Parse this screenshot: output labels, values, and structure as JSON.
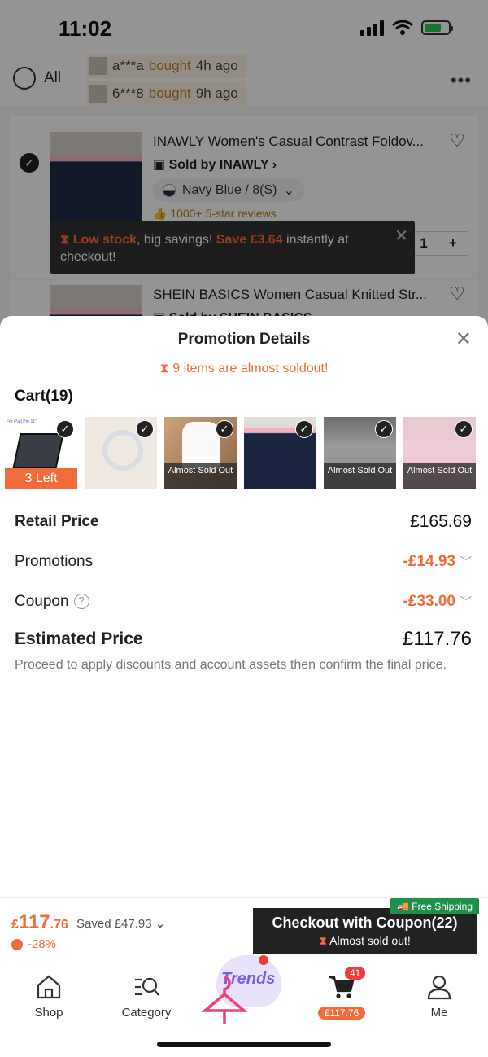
{
  "status": {
    "time": "11:02"
  },
  "cart_header": {
    "all_label": "All",
    "recent": [
      {
        "user": "a***a",
        "action": "bought",
        "when": "4h ago"
      },
      {
        "user": "6***8",
        "action": "bought",
        "when": "9h ago"
      }
    ]
  },
  "items": [
    {
      "title": "INAWLY Women's Casual Contrast Foldov...",
      "seller": "Sold by INAWLY",
      "variant": "Navy Blue / 8(S)",
      "reviews": "1000+ 5-star reviews",
      "qty": "1"
    },
    {
      "title": "SHEIN BASICS Women Casual Knitted Str...",
      "seller": "Sold by SHEIN BASICS"
    }
  ],
  "toast": {
    "part1": "Low stock",
    "part2": ", big savings! ",
    "part3": "Save £3.64",
    "part4": " instantly at checkout!"
  },
  "sheet": {
    "title": "Promotion Details",
    "soldout_note": "9 items are almost soldout!",
    "cart_label": "Cart(19)",
    "thumbs": [
      {
        "badge": "3 Left"
      },
      {
        "badge": ""
      },
      {
        "badge": "Almost Sold Out"
      },
      {
        "badge": ""
      },
      {
        "badge": "Almost Sold Out"
      },
      {
        "badge": "Almost Sold Out"
      }
    ],
    "retail_label": "Retail Price",
    "retail_value": "£165.69",
    "promotions_label": "Promotions",
    "promotions_value": "-£14.93",
    "coupon_label": "Coupon",
    "coupon_value": "-£33.00",
    "estimated_label": "Estimated Price",
    "estimated_value": "£117.76",
    "disclaimer": "Proceed to apply discounts and account assets then confirm the final price."
  },
  "checkout": {
    "currency": "£",
    "price_int": "117",
    "price_dec": ".76",
    "saved": "Saved £47.93",
    "discount_pct": "-28%",
    "button_label": "Checkout with Coupon(22)",
    "button_sub": "Almost sold out!",
    "free_shipping": "Free Shipping"
  },
  "tabbar": {
    "shop": "Shop",
    "category": "Category",
    "trends": "Trends",
    "cart_badge": "41",
    "cart_total": "£117.76",
    "me": "Me"
  },
  "colors": {
    "accent": "#f26b3a",
    "dark": "#222222",
    "free_ship": "#1f8f4e",
    "trends": "#7a5af0"
  }
}
